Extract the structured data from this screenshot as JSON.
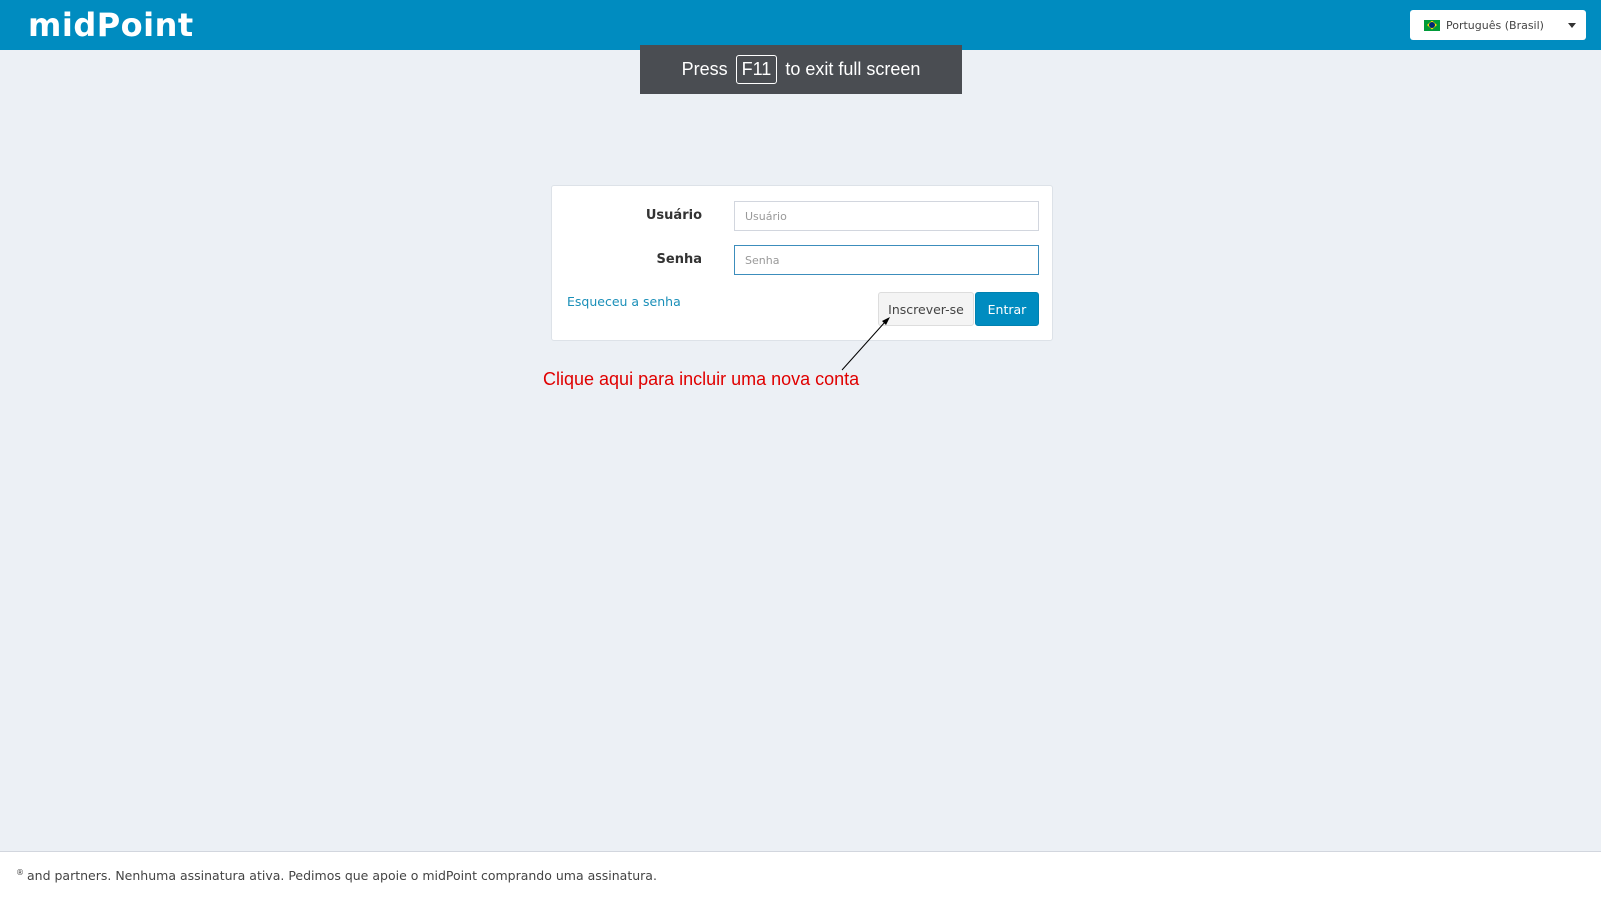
{
  "header": {
    "logo": "midPoint",
    "language": {
      "flag_icon": "flag-brazil-icon",
      "selected": "Português (Brasil)"
    }
  },
  "fullscreen_notice": {
    "prefix": "Press",
    "key": "F11",
    "suffix": "to exit full screen"
  },
  "login": {
    "username_label": "Usuário",
    "username_placeholder": "Usuário",
    "username_value": "",
    "password_label": "Senha",
    "password_placeholder": "Senha",
    "password_value": "",
    "forgot_link": "Esqueceu a senha",
    "register_button": "Inscrever-se",
    "login_button": "Entrar"
  },
  "annotation": {
    "text": "Clique aqui para incluir uma nova conta",
    "color": "#e00000"
  },
  "footer": {
    "text": "and partners. Nenhuma assinatura ativa. Pedimos que apoie o midPoint comprando uma assinatura.",
    "sup": "®"
  },
  "colors": {
    "header_bg": "#008cc0",
    "page_bg": "#ecf0f5",
    "link": "#1a8fb8",
    "primary_button": "#008cc0"
  }
}
